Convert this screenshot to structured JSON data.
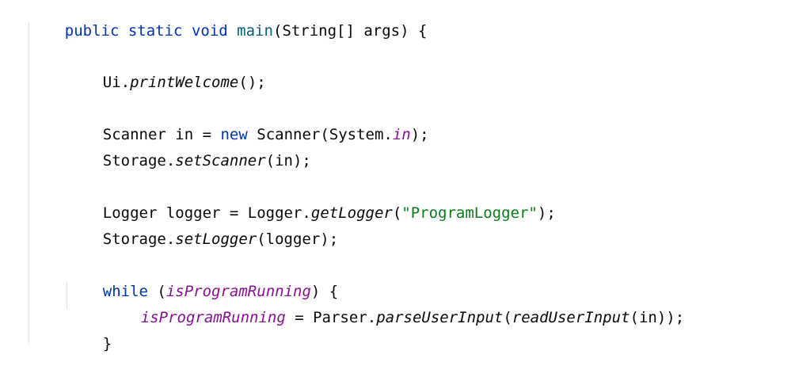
{
  "colors": {
    "keyword": "#0033b3",
    "method_declaration": "#00627a",
    "field": "#871094",
    "string": "#067d17",
    "text": "#080808",
    "indent_guide": "#e3e3e3",
    "background": "#ffffff"
  },
  "code": {
    "line1": {
      "kw_public": "public",
      "kw_static": "static",
      "kw_void": "void",
      "method_name": "main",
      "rest": "(String[] args) {"
    },
    "line2": {
      "class_name": "Ui.",
      "method": "printWelcome",
      "rest": "();"
    },
    "line3": {
      "type_and_var": "Scanner in = ",
      "kw_new": "new",
      "ctor": " Scanner(System.",
      "field": "in",
      "rest": ");"
    },
    "line4": {
      "class_name": "Storage.",
      "method": "setScanner",
      "rest": "(in);"
    },
    "line5": {
      "decl": "Logger logger = Logger.",
      "method": "getLogger",
      "open": "(",
      "string": "\"ProgramLogger\"",
      "close": ");"
    },
    "line6": {
      "class_name": "Storage.",
      "method": "setLogger",
      "rest": "(logger);"
    },
    "line7": {
      "kw_while": "while",
      "open": " (",
      "var": "isProgramRunning",
      "rest": ") {"
    },
    "line8": {
      "var": "isProgramRunning",
      "assign": " = Parser.",
      "method1": "parseUserInput",
      "open": "(",
      "method2": "readUserInput",
      "rest": "(in));"
    },
    "line9": {
      "brace": "}"
    }
  }
}
